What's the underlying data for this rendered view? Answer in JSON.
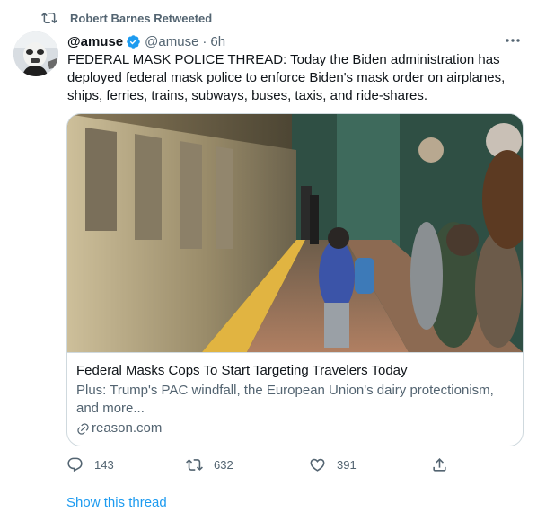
{
  "retweet": {
    "label": "Robert Barnes Retweeted"
  },
  "tweet": {
    "display_name": "@amuse",
    "handle": "@amuse",
    "separator": "·",
    "time": "6h",
    "text": "FEDERAL MASK POLICE THREAD: Today the Biden administration has deployed federal mask police to enforce Biden's mask order on airplanes, ships, ferries, trains, subways, buses, taxis, and ride-shares."
  },
  "card": {
    "title": "Federal Masks Cops To Start Targeting Travelers Today",
    "description": "Plus: Trump's PAC windfall, the European Union's dairy protectionism, and more...",
    "domain": "reason.com"
  },
  "actions": {
    "reply_count": "143",
    "retweet_count": "632",
    "like_count": "391"
  },
  "thread": {
    "label": "Show this thread"
  },
  "colors": {
    "accent": "#1d9bf0",
    "secondary_text": "#536471",
    "border": "#cfd9de"
  },
  "icons": [
    "retweet-icon",
    "verified-badge-icon",
    "more-icon",
    "link-icon",
    "reply-icon",
    "like-icon",
    "share-icon"
  ]
}
